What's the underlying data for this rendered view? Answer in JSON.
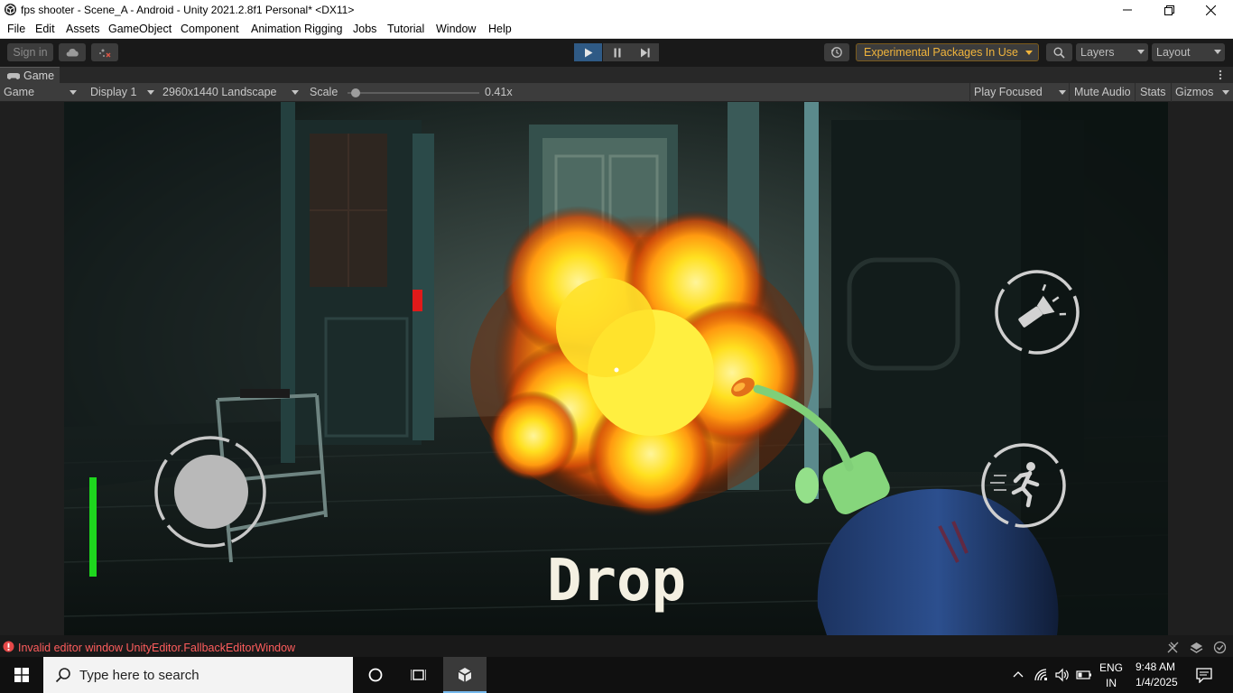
{
  "window": {
    "title": "fps shooter - Scene_A - Android - Unity 2021.2.8f1 Personal* <DX11>"
  },
  "menu": {
    "items": [
      "File",
      "Edit",
      "Assets",
      "GameObject",
      "Component",
      "Animation Rigging",
      "Jobs",
      "Tutorial",
      "Window",
      "Help"
    ]
  },
  "toolbar": {
    "sign_in": "Sign in",
    "experimental": "Experimental Packages In Use",
    "layers": "Layers",
    "layout": "Layout",
    "play_active": true
  },
  "game_tab": {
    "label": "Game"
  },
  "game_bar": {
    "mode": "Game",
    "display": "Display 1",
    "resolution": "2960x1440 Landscape",
    "scale_label": "Scale",
    "scale_value": "0.41x",
    "scale_fraction": 0.05,
    "play_focused": "Play Focused",
    "mute_audio": "Mute Audio",
    "stats": "Stats",
    "gizmos": "Gizmos"
  },
  "game": {
    "action_text": "Drop",
    "health_fraction": 1.0
  },
  "status": {
    "message": "Invalid editor window UnityEditor.FallbackEditorWindow"
  },
  "taskbar": {
    "search_placeholder": "Type here to search",
    "lang_top": "ENG",
    "lang_bottom": "IN",
    "time": "9:48 AM",
    "date": "1/4/2025"
  },
  "colors": {
    "accent_play": "#2f5a85",
    "experimental_text": "#f0b43c",
    "error": "#ff5d5d",
    "health": "#1ed61e"
  },
  "icons": {
    "cloud": "cloud-icon",
    "collab": "collab-icon",
    "history": "history-icon",
    "search": "search-icon",
    "flashlight": "flashlight-icon",
    "run": "run-icon"
  }
}
